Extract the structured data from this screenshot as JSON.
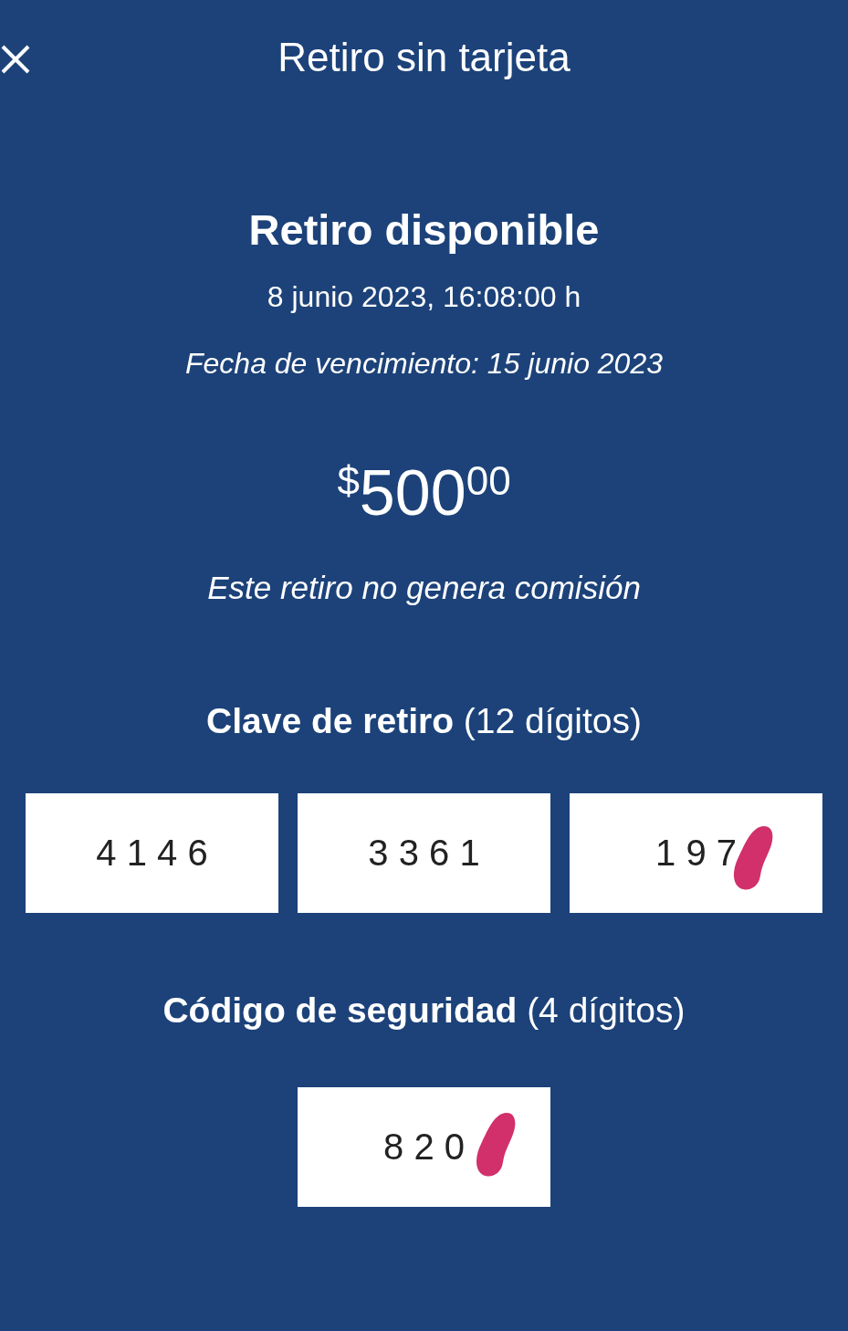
{
  "header": {
    "title": "Retiro sin tarjeta"
  },
  "withdrawal": {
    "heading": "Retiro disponible",
    "date": "8 junio 2023, 16:08:00 h",
    "expiry": "Fecha de vencimiento: 15 junio 2023",
    "amount": {
      "currency": "$",
      "whole": "500",
      "cents": "00"
    },
    "fee_note": "Este retiro no genera comisión"
  },
  "withdrawal_code": {
    "label": "**Clave de retiro** (12 dígitos)",
    "groups": [
      {
        "digits": "4 1 4 6",
        "redacted": false
      },
      {
        "digits": "3 3 6 1",
        "redacted": false
      },
      {
        "digits": "1 9 7",
        "redacted": true
      }
    ]
  },
  "security_code": {
    "label": "**Código de seguridad** (4 dígitos)",
    "groups": [
      {
        "digits": "8 2 0",
        "redacted": true
      }
    ]
  }
}
